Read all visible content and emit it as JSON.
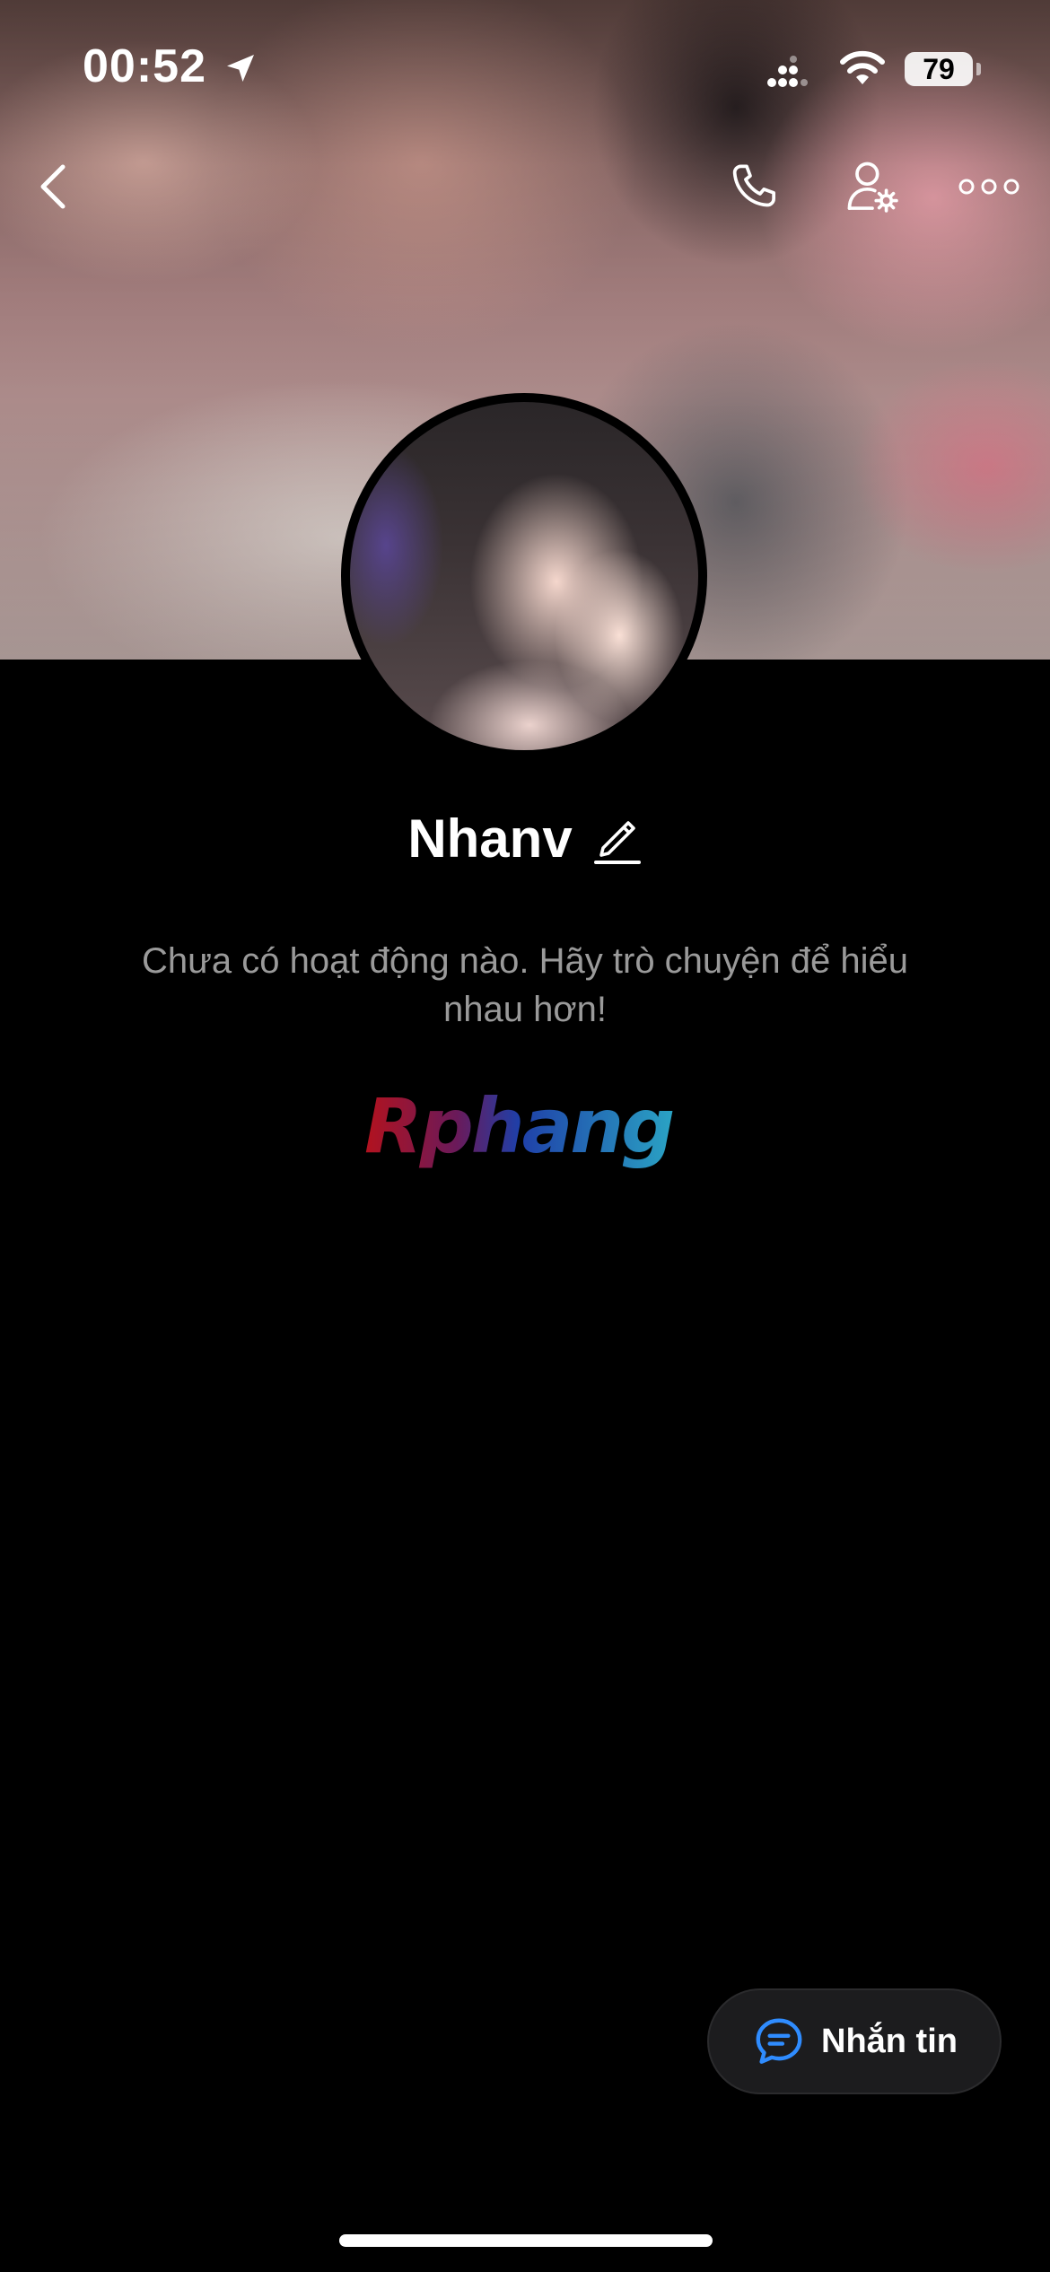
{
  "status_bar": {
    "time": "00:52",
    "battery": "79"
  },
  "icons": {
    "back": "chevron-left-icon",
    "call": "phone-icon",
    "settings": "user-settings-icon",
    "more": "more-horizontal-icon",
    "edit": "pencil-icon",
    "message": "chat-bubble-icon"
  },
  "profile": {
    "name": "Nhanv",
    "empty_message": "Chưa có hoạt động nào. Hãy trò chuyện để hiểu nhau hơn!"
  },
  "watermark": {
    "text": "Rphang"
  },
  "actions": {
    "message_label": "Nhắn tin"
  },
  "colors": {
    "accent": "#2f8cff",
    "background": "#000000",
    "muted_text": "#9a9a9a"
  }
}
